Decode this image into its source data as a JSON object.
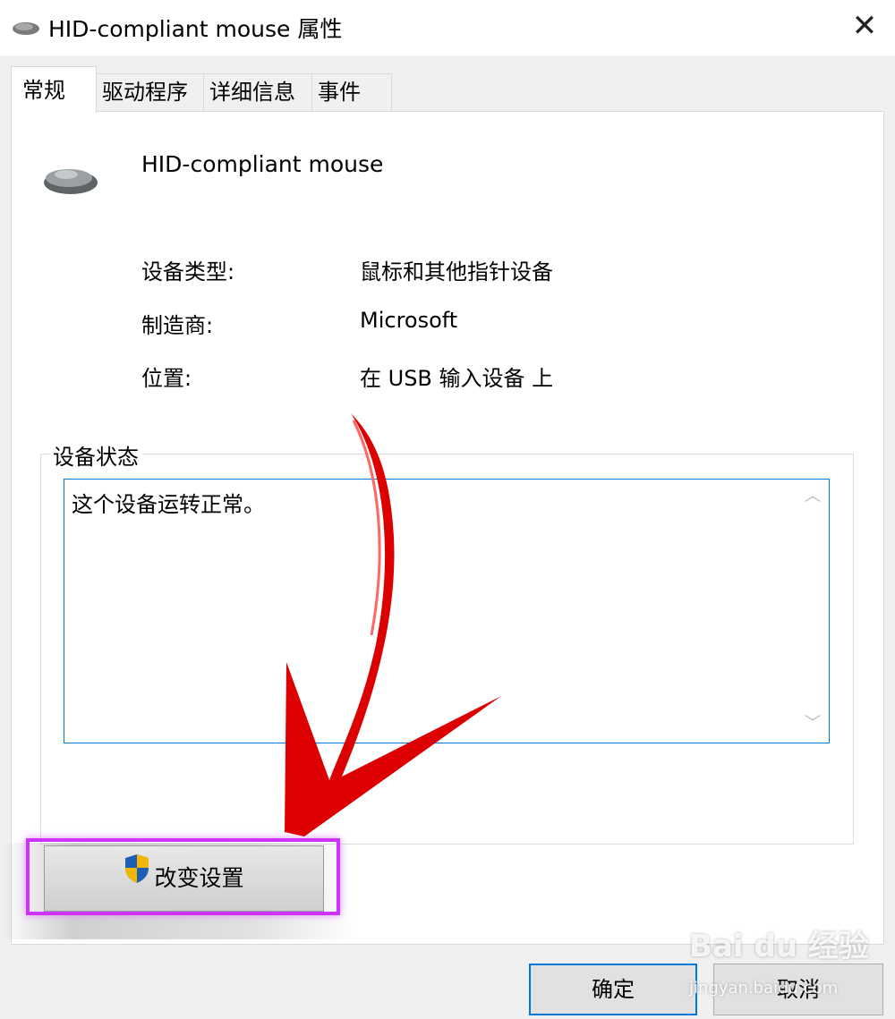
{
  "window": {
    "title": "HID-compliant mouse 属性",
    "close_glyph": "✕"
  },
  "tabs": [
    {
      "label": "常规",
      "active": true
    },
    {
      "label": "驱动程序",
      "active": false
    },
    {
      "label": "详细信息",
      "active": false
    },
    {
      "label": "事件",
      "active": false
    }
  ],
  "device": {
    "name": "HID-compliant mouse",
    "icon": "mouse-icon"
  },
  "properties": [
    {
      "label": "设备类型:",
      "value": "鼠标和其他指针设备"
    },
    {
      "label": "制造商:",
      "value": "Microsoft"
    },
    {
      "label": "位置:",
      "value": "在 USB 输入设备 上"
    }
  ],
  "status": {
    "group_label": "设备状态",
    "text": "这个设备运转正常。"
  },
  "buttons": {
    "change_settings": "改变设置",
    "ok": "确定",
    "cancel": "取消"
  },
  "watermark": {
    "brand": "Bai du 经验",
    "url": "jingyan.baidu.com"
  },
  "colors": {
    "accent": "#0078d7",
    "highlight": "#cc33ff",
    "arrow": "#dd0000"
  }
}
